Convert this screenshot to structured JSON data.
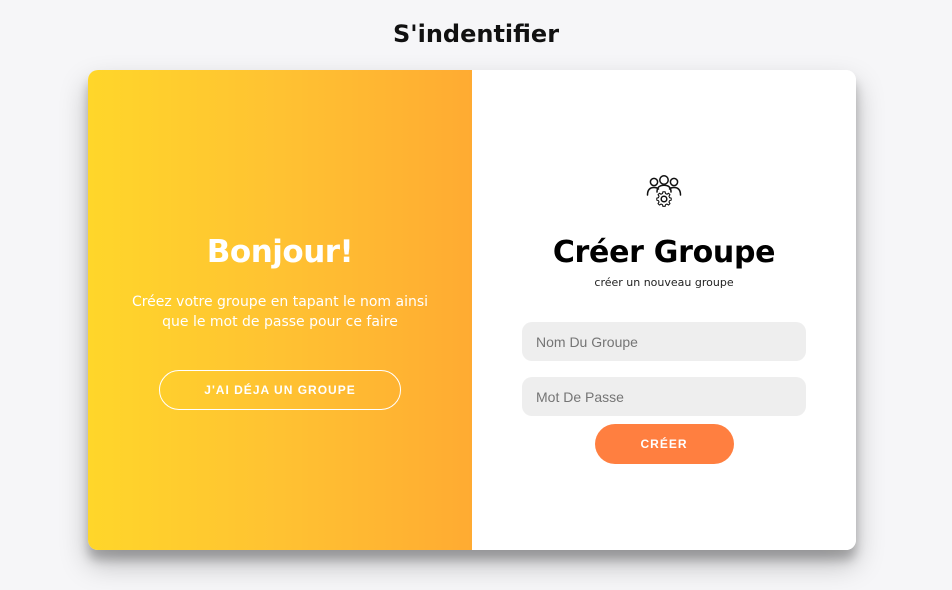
{
  "page": {
    "title": "S'indentifier"
  },
  "overlay": {
    "heading": "Bonjour!",
    "text": "Créez votre groupe en tapant le nom ainsi que le mot de passe pour ce faire",
    "button_label": "J'ai déja un groupe",
    "gradient_start": "#ffd62a",
    "gradient_end": "#ffab32"
  },
  "form": {
    "icon": "group-settings-icon",
    "heading": "Créer Groupe",
    "subtitle": "créer un nouveau groupe",
    "group_name": {
      "placeholder": "Nom Du Groupe",
      "value": ""
    },
    "password": {
      "placeholder": "Mot De Passe",
      "value": ""
    },
    "submit_label": "Créer",
    "accent_color": "#ff7f40"
  }
}
